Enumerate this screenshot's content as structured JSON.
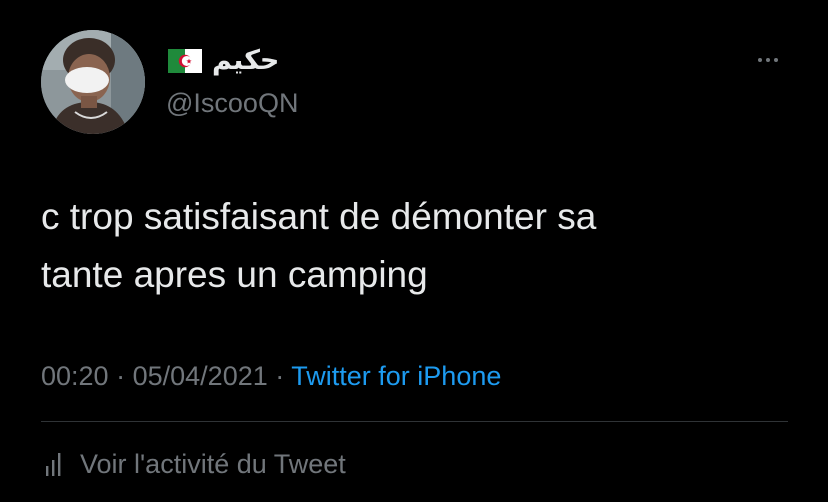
{
  "tweet": {
    "author": {
      "display_name": "حكيم",
      "flag": "algeria-flag",
      "handle": "@IscooQN",
      "avatar": "profile-photo"
    },
    "more_icon": "more-horizontal-icon",
    "text": "c trop satisfaisant de démonter sa\ntante apres un camping",
    "time": "00:20",
    "date": "05/04/2021",
    "separator": "·",
    "source": "Twitter for iPhone",
    "activity": {
      "icon": "analytics-icon",
      "label": "Voir l'activité du Tweet"
    }
  },
  "colors": {
    "background": "#000000",
    "text": "#e7e9ea",
    "secondary": "#71767b",
    "link": "#1d9bf0",
    "divider": "#2f3336"
  }
}
